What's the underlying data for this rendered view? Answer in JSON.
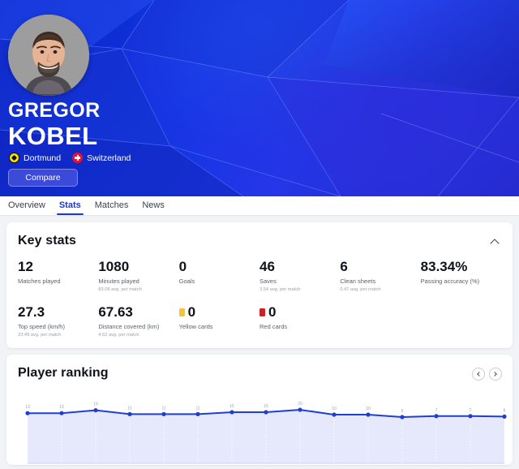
{
  "hero": {
    "first_name": "GREGOR",
    "last_name": "KOBEL",
    "club": "Dortmund",
    "country": "Switzerland",
    "compare_label": "Compare",
    "club_badge_icon": "dortmund-crest-icon",
    "country_badge_icon": "switzerland-flag-icon",
    "avatar_icon": "player-portrait-avatar"
  },
  "tabs": [
    {
      "label": "Overview",
      "active": false
    },
    {
      "label": "Stats",
      "active": true
    },
    {
      "label": "Matches",
      "active": false
    },
    {
      "label": "News",
      "active": false
    }
  ],
  "key_stats": {
    "title": "Key stats",
    "collapse_icon": "chevron-up-icon",
    "items": [
      {
        "value": "12",
        "label": "Matches played",
        "sub": "",
        "chip": ""
      },
      {
        "value": "1080",
        "label": "Minutes played",
        "sub": "83.08 avg. per match",
        "chip": ""
      },
      {
        "value": "0",
        "label": "Goals",
        "sub": "",
        "chip": ""
      },
      {
        "value": "46",
        "label": "Saves",
        "sub": "3.54 avg. per match",
        "chip": ""
      },
      {
        "value": "6",
        "label": "Clean sheets",
        "sub": "0.47 avg. per match",
        "chip": ""
      },
      {
        "value": "83.34%",
        "label": "Passing accuracy (%)",
        "sub": "",
        "chip": ""
      },
      {
        "value": "27.3",
        "label": "Top speed (km/h)",
        "sub": "23.49 avg. per match",
        "chip": ""
      },
      {
        "value": "67.63",
        "label": "Distance covered (km)",
        "sub": "4.62 avg. per match",
        "chip": ""
      },
      {
        "value": "0",
        "label": "Yellow cards",
        "sub": "",
        "chip": "yellow"
      },
      {
        "value": "0",
        "label": "Red cards",
        "sub": "",
        "chip": "red"
      }
    ]
  },
  "player_ranking": {
    "title": "Player ranking",
    "prev_icon": "chevron-left-icon",
    "next_icon": "chevron-right-icon"
  },
  "chart_data": {
    "type": "line",
    "title": "Player ranking",
    "xlabel": "",
    "ylabel": "",
    "grid": true,
    "legend_position": "none",
    "line_color": "#1f3fd4",
    "fill_color": "#e4e8fb",
    "point_labels": [
      "13",
      "13",
      "19",
      "11",
      "11",
      "11",
      "15",
      "15",
      "20",
      "10",
      "10",
      "5",
      "7",
      "7",
      "6"
    ],
    "values": [
      13,
      13,
      19,
      11,
      11,
      11,
      15,
      15,
      20,
      10,
      10,
      5,
      7,
      7,
      6
    ],
    "x": [
      1,
      2,
      3,
      4,
      5,
      6,
      7,
      8,
      9,
      10,
      11,
      12,
      13,
      14,
      15
    ],
    "ylim": [
      0,
      22
    ]
  },
  "colors": {
    "brand_blue": "#1a38d8",
    "hero_blue": "#1035de",
    "yellow_card": "#f5c431",
    "red_card": "#cc2222",
    "chart_line": "#1f3fd4"
  }
}
